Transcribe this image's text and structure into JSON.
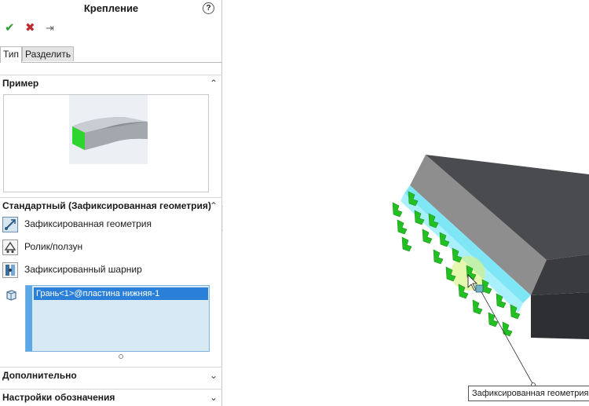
{
  "panel": {
    "title": "Крепление",
    "help_icon": "?",
    "actions": {
      "ok": "✔",
      "cancel": "✖",
      "pin": "⇥"
    },
    "tabs": [
      {
        "label": "Тип"
      },
      {
        "label": "Разделить"
      }
    ],
    "sections": {
      "example": "Пример",
      "standard": "Стандартный (Зафиксированная геометрия)",
      "advanced": "Дополнительно",
      "symbol_settings": "Настройки обозначения"
    },
    "options": [
      {
        "label": "Зафиксированная геометрия",
        "icon": "fixed-geometry-icon"
      },
      {
        "label": "Ролик/ползун",
        "icon": "roller-slider-icon"
      },
      {
        "label": "Зафиксированный шарнир",
        "icon": "fixed-hinge-icon"
      }
    ],
    "selection": {
      "items": [
        "Грань<1>@пластина нижняя-1"
      ]
    }
  },
  "viewport": {
    "tooltip": "Зафиксированная геометрия:"
  },
  "colors": {
    "accent": "#2a7fd8",
    "selection_bg": "#d8e9f6",
    "face_highlight": "#7fe6f5",
    "fixture_arrow": "#22c022",
    "check": "#2e9e2e",
    "cross": "#c0282d"
  }
}
